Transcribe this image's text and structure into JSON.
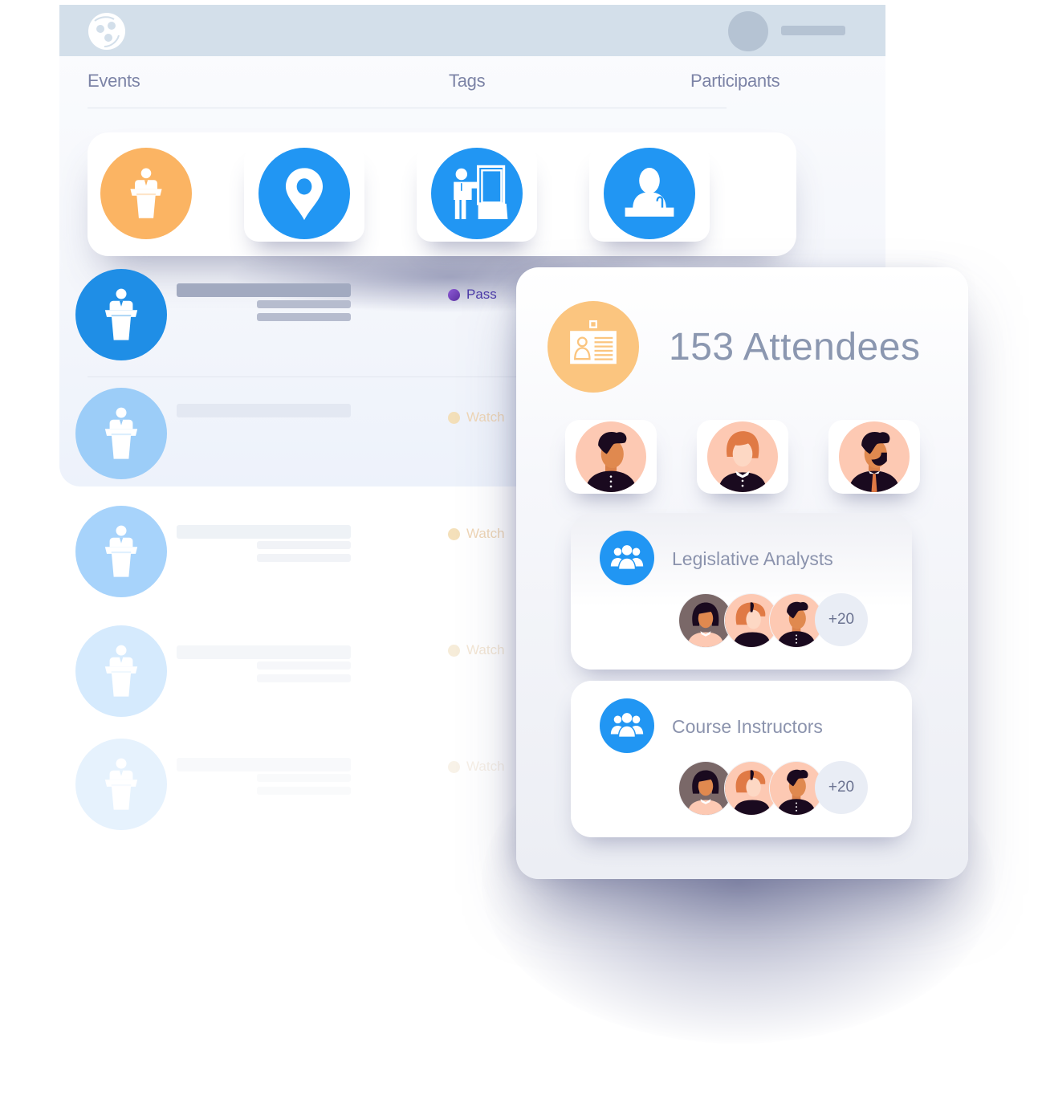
{
  "app": {
    "logo_icon": "people-circle-logo-icon",
    "user_avatar_icon": "user-avatar-placeholder"
  },
  "nav": {
    "tabs": [
      {
        "label": "Events"
      },
      {
        "label": "Tags"
      },
      {
        "label": "Participants"
      }
    ]
  },
  "categories": [
    {
      "icon": "podium-speaker-icon",
      "color": "#fbb463"
    },
    {
      "icon": "location-pin-icon",
      "color": "#2196f3"
    },
    {
      "icon": "presenter-board-icon",
      "color": "#2196f3"
    },
    {
      "icon": "person-at-desk-microphone-icon",
      "color": "#2196f3"
    }
  ],
  "events": [
    {
      "icon": "podium-speaker-icon",
      "status": "Pass",
      "status_color": "#6a3fb0"
    },
    {
      "icon": "podium-speaker-icon",
      "status": "Watch",
      "status_color": "#f1c27a"
    },
    {
      "icon": "podium-speaker-icon",
      "status": "Watch",
      "status_color": "#f1c27a"
    },
    {
      "icon": "podium-speaker-icon",
      "status": "Watch",
      "status_color": "#f1c27a"
    },
    {
      "icon": "podium-speaker-icon",
      "status": "Watch",
      "status_color": "#f1c27a"
    }
  ],
  "attendees": {
    "title": "153 Attendees",
    "icon": "id-badge-icon",
    "featured": [
      {
        "avatar": "man-curly-hair-avatar"
      },
      {
        "avatar": "woman-red-bob-avatar"
      },
      {
        "avatar": "man-beard-tie-avatar"
      }
    ],
    "groups": [
      {
        "name": "Legislative Analysts",
        "icon": "group-people-icon",
        "more": "+20"
      },
      {
        "name": "Course Instructors",
        "icon": "group-people-icon",
        "more": "+20"
      }
    ]
  },
  "colors": {
    "primary_blue": "#2196f3",
    "accent_orange": "#fbb463",
    "text_muted": "#8b97b0"
  }
}
